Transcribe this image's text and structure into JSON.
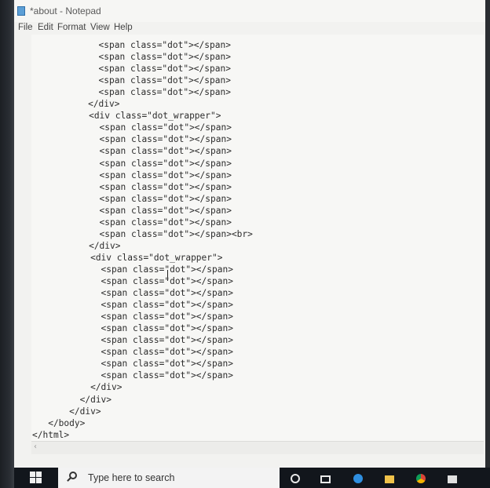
{
  "window": {
    "title": "*about - Notepad",
    "accent": "#5c9fd6"
  },
  "menu": {
    "items": [
      "File",
      "Edit",
      "Format",
      "View",
      "Help"
    ]
  },
  "editor": {
    "lines": [
      "             <span class=\"dot\"></span>",
      "             <span class=\"dot\"></span>",
      "             <span class=\"dot\"></span>",
      "             <span class=\"dot\"></span>",
      "             <span class=\"dot\"></span>",
      "           </div>",
      "           <div class=\"dot_wrapper\">",
      "             <span class=\"dot\"></span>",
      "             <span class=\"dot\"></span>",
      "             <span class=\"dot\"></span>",
      "             <span class=\"dot\"></span>",
      "             <span class=\"dot\"></span>",
      "             <span class=\"dot\"></span>",
      "             <span class=\"dot\"></span>",
      "             <span class=\"dot\"></span>",
      "             <span class=\"dot\"></span>",
      "             <span class=\"dot\"></span><br>",
      "           </div>",
      "           <div class=\"dot_wrapper\">",
      "             <span class=\"dot\"></span>",
      "             <span class=\"dot\"></span>",
      "             <span class=\"dot\"></span>",
      "             <span class=\"dot\"></span>",
      "             <span class=\"dot\"></span>",
      "             <span class=\"dot\"></span>",
      "             <span class=\"dot\"></span>",
      "             <span class=\"dot\"></span>",
      "             <span class=\"dot\"></span>",
      "             <span class=\"dot\"></span>",
      "           </div>",
      "         </div>",
      "       </div>",
      "   </body>",
      "</html>"
    ]
  },
  "taskbar": {
    "search_placeholder": "Type here to search",
    "icons": [
      "cortana-icon",
      "task-view-icon",
      "edge-icon",
      "file-explorer-icon",
      "chrome-icon",
      "store-icon"
    ]
  }
}
